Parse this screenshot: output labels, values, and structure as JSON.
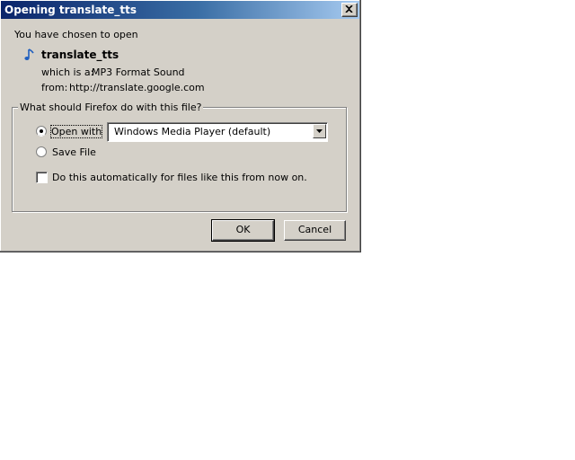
{
  "dialog": {
    "title": "Opening translate_tts",
    "intro": "You have chosen to open",
    "file": {
      "icon": "music-note-icon",
      "name": "translate_tts",
      "type_label": "which is a:",
      "type_value": "MP3 Format Sound",
      "from_label": "from:",
      "from_value": "http://translate.google.com"
    },
    "group": {
      "legend": "What should Firefox do with this file?",
      "open_with_label": "Open with",
      "open_with_selected": true,
      "application": "Windows Media Player (default)",
      "save_label": "Save File",
      "save_selected": false,
      "auto_label": "Do this automatically for files like this from now on.",
      "auto_checked": false
    },
    "buttons": {
      "ok": "OK",
      "cancel": "Cancel"
    }
  }
}
